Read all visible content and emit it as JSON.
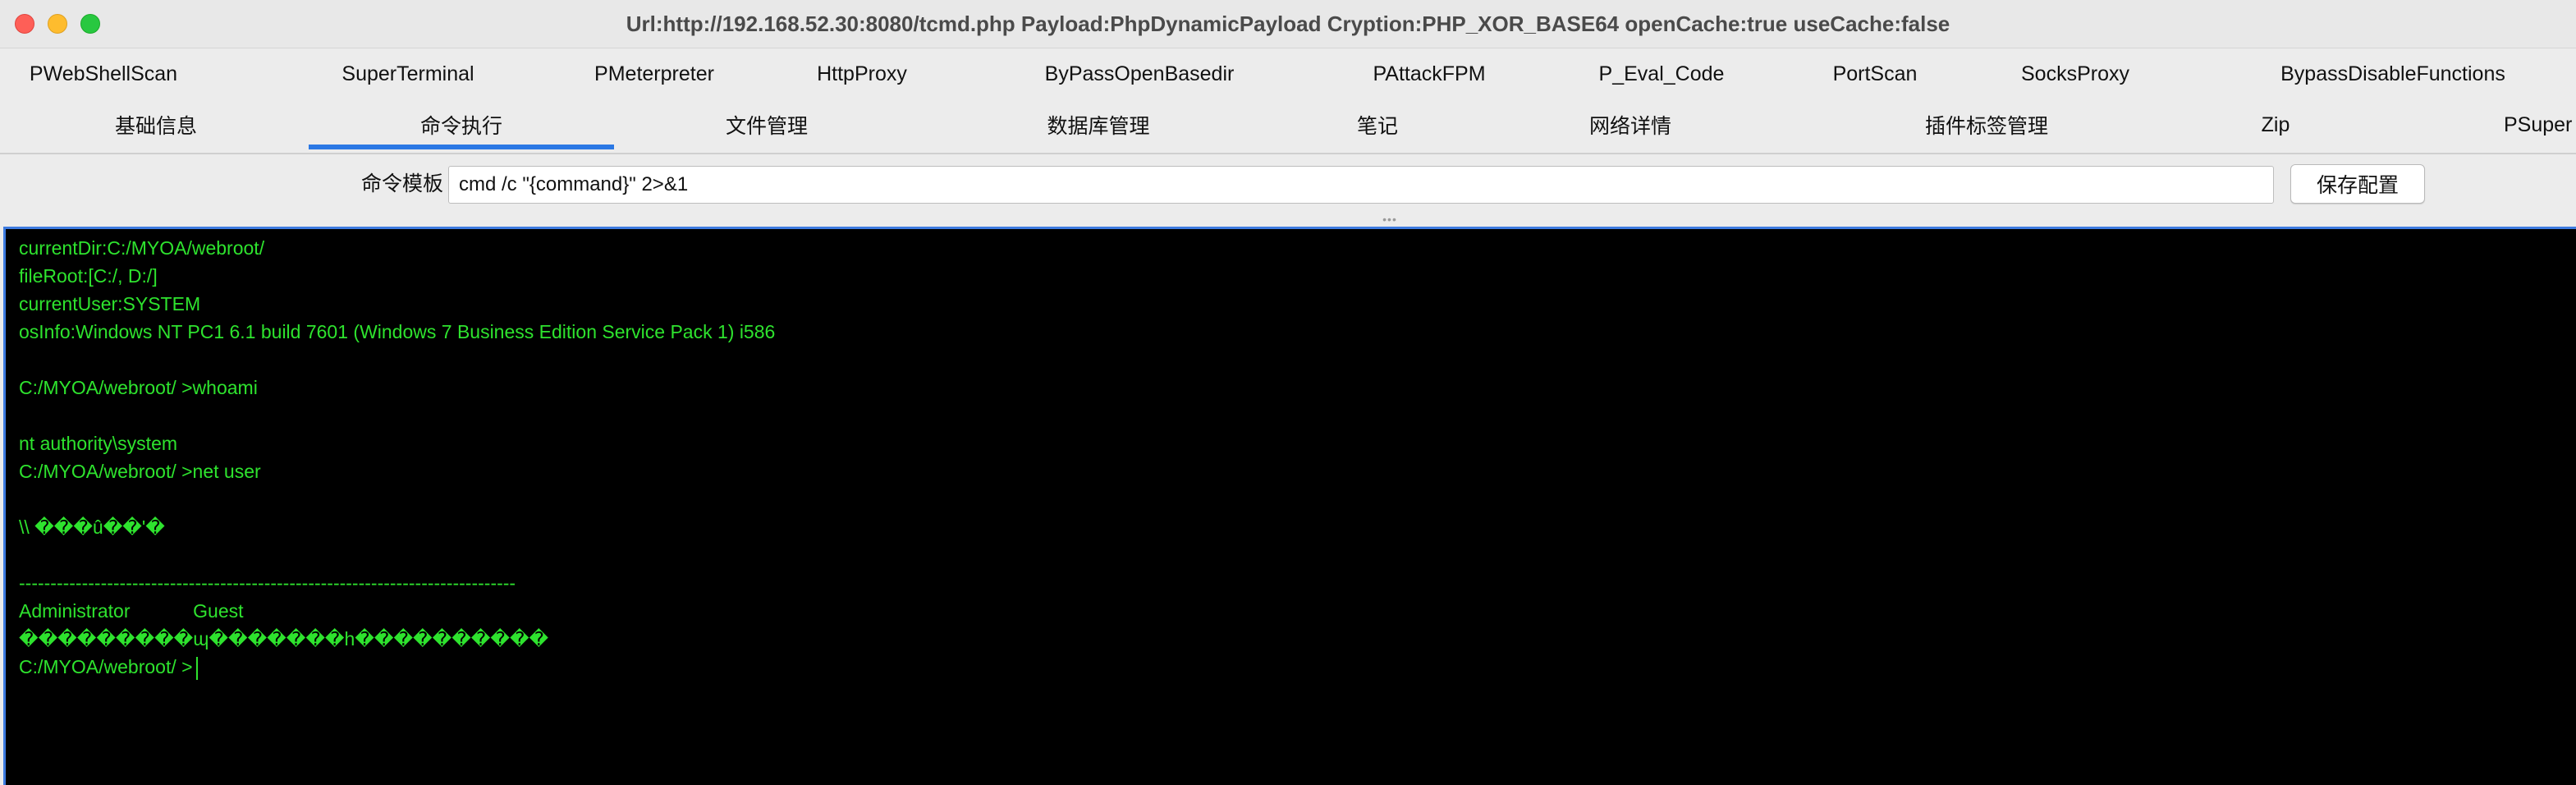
{
  "window": {
    "title": "Url:http://192.168.52.30:8080/tcmd.php Payload:PhpDynamicPayload Cryption:PHP_XOR_BASE64 openCache:true useCache:false"
  },
  "tabs_row1": [
    {
      "label": "PWebShellScan"
    },
    {
      "label": "SuperTerminal"
    },
    {
      "label": "PMeterpreter"
    },
    {
      "label": "HttpProxy"
    },
    {
      "label": "ByPassOpenBasedir"
    },
    {
      "label": "PAttackFPM"
    },
    {
      "label": "P_Eval_Code"
    },
    {
      "label": "PortScan"
    },
    {
      "label": "SocksProxy"
    },
    {
      "label": "BypassDisableFunctions"
    }
  ],
  "tabs_row2": [
    {
      "label": "基础信息",
      "active": false
    },
    {
      "label": "命令执行",
      "active": true
    },
    {
      "label": "文件管理",
      "active": false
    },
    {
      "label": "数据库管理",
      "active": false
    },
    {
      "label": "笔记",
      "active": false
    },
    {
      "label": "网络详情",
      "active": false
    },
    {
      "label": "插件标签管理",
      "active": false
    },
    {
      "label": "Zip",
      "active": false
    },
    {
      "label": "PSuper",
      "active": false
    }
  ],
  "command_bar": {
    "label": "命令模板",
    "template_value": "cmd /c \"{command}\" 2>&1",
    "save_label": "保存配置"
  },
  "terminal": {
    "lines": [
      "currentDir:C:/MYOA/webroot/",
      "fileRoot:[C:/, D:/]",
      "currentUser:SYSTEM",
      "osInfo:Windows NT PC1 6.1 build 7601 (Windows 7 Business Edition Service Pack 1) i586",
      "",
      "C:/MYOA/webroot/ >whoami",
      "",
      "nt authority\\system",
      "C:/MYOA/webroot/ >net user",
      "",
      "\\\\ ���û��'�",
      "",
      "-------------------------------------------------------------------------------",
      "Administrator            Guest",
      "���������ɰ�������h����������",
      "C:/MYOA/webroot/ >"
    ]
  },
  "colors": {
    "terminal_bg": "#000000",
    "terminal_text": "#2ee32e",
    "accent": "#2b78e4"
  }
}
